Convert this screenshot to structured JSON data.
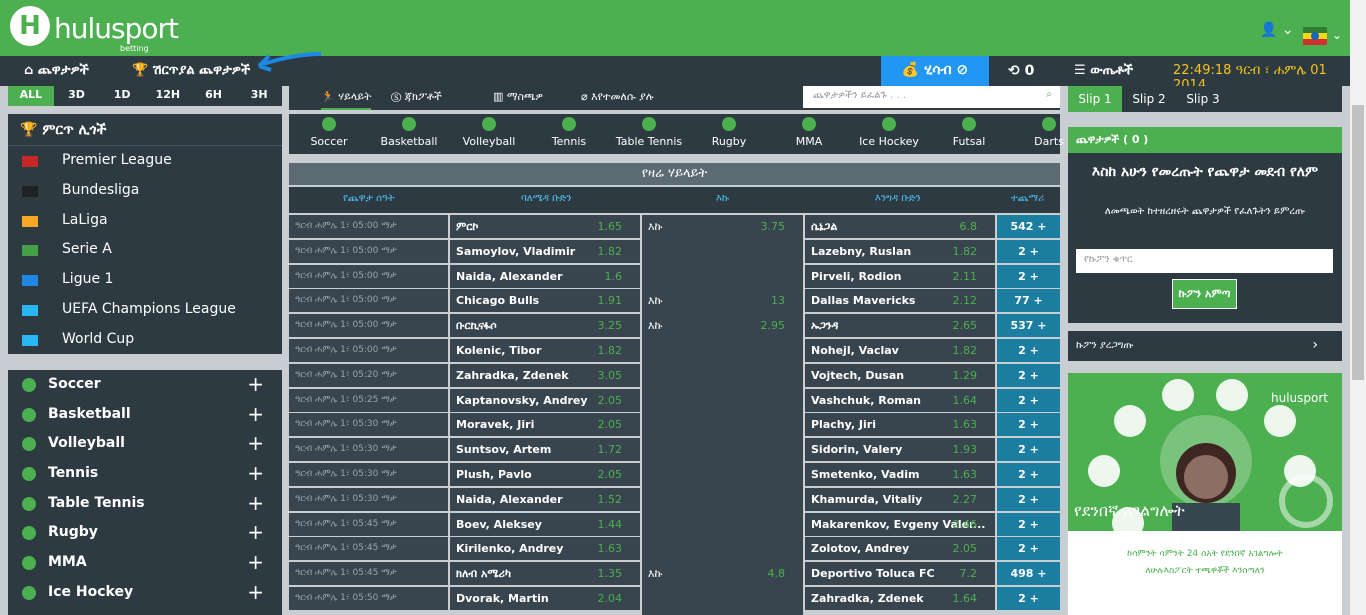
{
  "brand": {
    "name": "hulusport",
    "sub": "betting"
  },
  "nav": {
    "home": "ጨዋታዎች",
    "special": "ሽርጥያል ጨዋታዎች",
    "balance": "ሂሳብ",
    "history_count": "0",
    "tickets": "ውጤቶች",
    "clock": "22:49:18 ዓርብ ፣ ሐምሌ 01 2014"
  },
  "periods": [
    "ALL",
    "3D",
    "1D",
    "12H",
    "6H",
    "3H"
  ],
  "top_leagues_title": "ምርጥ ሊጎች",
  "leagues": [
    {
      "name": "Premier League",
      "flag": "#c62828"
    },
    {
      "name": "Bundesliga",
      "flag": "#212121"
    },
    {
      "name": "LaLiga",
      "flag": "#f9a825"
    },
    {
      "name": "Serie A",
      "flag": "#43a047"
    },
    {
      "name": "Ligue 1",
      "flag": "#1e88e5"
    },
    {
      "name": "UEFA Champions League",
      "flag": "#29b6f6"
    },
    {
      "name": "World Cup",
      "flag": "#29b6f6"
    }
  ],
  "sports": [
    "Soccer",
    "Basketball",
    "Volleyball",
    "Tennis",
    "Table Tennis",
    "Rugby",
    "MMA",
    "Ice Hockey"
  ],
  "tabs": [
    "ሃይላይት",
    "ጃክፖቶች",
    "ማስጫዎ",
    "እየተመለሱ ያሉ"
  ],
  "search_placeholder": "ጨዋታዎችን ይፈልጉ . . .",
  "sportsbar": [
    "Soccer",
    "Basketball",
    "Volleyball",
    "Tennis",
    "Table Tennis",
    "Rugby",
    "MMA",
    "Ice Hockey",
    "Futsal",
    "Darts"
  ],
  "highlights_title": "የዛሬ ሃይላይት",
  "columns": [
    "የጨዋታ ሰዓት",
    "ባለሜዳ ቡድን",
    "እኩ",
    "እንግዳ ቡድን",
    "ተጨማሪ"
  ],
  "rows": [
    {
      "time": "ዓርብ ሐምሌ 1፣ 05:00 ማታ",
      "home": "ምርኮ",
      "ho": "1.65",
      "draw": "እኩ",
      "do": "3.75",
      "away": "ሴኔጋል",
      "ao": "6.8",
      "more": "542 +"
    },
    {
      "time": "ዓርብ ሐምሌ 1፣ 05:00 ማታ",
      "home": "Samoylov, Vladimir",
      "ho": "1.82",
      "draw": "",
      "do": "",
      "away": "Lazebny, Ruslan",
      "ao": "1.82",
      "more": "2 +"
    },
    {
      "time": "ዓርብ ሐምሌ 1፣ 05:00 ማታ",
      "home": "Naida, Alexander",
      "ho": "1.6",
      "draw": "",
      "do": "",
      "away": "Pirveli, Rodion",
      "ao": "2.11",
      "more": "2 +"
    },
    {
      "time": "ዓርብ ሐምሌ 1፣ 05:00 ማታ",
      "home": "Chicago Bulls",
      "ho": "1.91",
      "draw": "እኩ",
      "do": "13",
      "away": "Dallas Mavericks",
      "ao": "2.12",
      "more": "77 +"
    },
    {
      "time": "ዓርብ ሐምሌ 1፣ 05:00 ማታ",
      "home": "ቡርኪናፋሶ",
      "ho": "3.25",
      "draw": "እኩ",
      "do": "2.95",
      "away": "ኡጋንዳ",
      "ao": "2.65",
      "more": "537 +"
    },
    {
      "time": "ዓርብ ሐምሌ 1፣ 05:00 ማታ",
      "home": "Kolenic, Tibor",
      "ho": "1.82",
      "draw": "",
      "do": "",
      "away": "Nohejl, Vaclav",
      "ao": "1.82",
      "more": "2 +"
    },
    {
      "time": "ዓርብ ሐምሌ 1፣ 05:20 ማታ",
      "home": "Zahradka, Zdenek",
      "ho": "3.05",
      "draw": "",
      "do": "",
      "away": "Vojtech, Dusan",
      "ao": "1.29",
      "more": "2 +"
    },
    {
      "time": "ዓርብ ሐምሌ 1፣ 05:25 ማታ",
      "home": "Kaptanovsky, Andrey",
      "ho": "2.05",
      "draw": "",
      "do": "",
      "away": "Vashchuk, Roman",
      "ao": "1.64",
      "more": "2 +"
    },
    {
      "time": "ዓርብ ሐምሌ 1፣ 05:30 ማታ",
      "home": "Moravek, Jiri",
      "ho": "2.05",
      "draw": "",
      "do": "",
      "away": "Plachy, Jiri",
      "ao": "1.63",
      "more": "2 +"
    },
    {
      "time": "ዓርብ ሐምሌ 1፣ 05:30 ማታ",
      "home": "Suntsov, Artem",
      "ho": "1.72",
      "draw": "",
      "do": "",
      "away": "Sidorin, Valery",
      "ao": "1.93",
      "more": "2 +"
    },
    {
      "time": "ዓርብ ሐምሌ 1፣ 05:30 ማታ",
      "home": "Plush, Pavlo",
      "ho": "2.05",
      "draw": "",
      "do": "",
      "away": "Smetenko, Vadim",
      "ao": "1.63",
      "more": "2 +"
    },
    {
      "time": "ዓርብ ሐምሌ 1፣ 05:30 ማታ",
      "home": "Naida, Alexander",
      "ho": "1.52",
      "draw": "",
      "do": "",
      "away": "Khamurda, Vitaliy",
      "ao": "2.27",
      "more": "2 +"
    },
    {
      "time": "ዓርብ ሐምሌ 1፣ 05:45 ማታ",
      "home": "Boev, Aleksey",
      "ho": "1.44",
      "draw": "",
      "do": "",
      "away": "Makarenkov, Evgeny Valer...",
      "ao": "2.46",
      "more": "2 +"
    },
    {
      "time": "ዓርብ ሐምሌ 1፣ 05:45 ማታ",
      "home": "Kirilenko, Andrey",
      "ho": "1.63",
      "draw": "",
      "do": "",
      "away": "Zolotov, Andrey",
      "ao": "2.05",
      "more": "2 +"
    },
    {
      "time": "ዓርብ ሐምሌ 1፣ 05:45 ማታ",
      "home": "ክለብ አሜሪካ",
      "ho": "1.35",
      "draw": "እኩ",
      "do": "4.8",
      "away": "Deportivo Toluca FC",
      "ao": "7.2",
      "more": "498 +"
    },
    {
      "time": "ዓርብ ሐምሌ 1፣ 05:50 ማታ",
      "home": "Dvorak, Martin",
      "ho": "2.04",
      "draw": "",
      "do": "",
      "away": "Zahradka, Zdenek",
      "ao": "1.64",
      "more": "2 +"
    }
  ],
  "slips": [
    "Slip 1",
    "Slip 2",
    "Slip 3"
  ],
  "betslip": {
    "header": "ጨዋታዎች ( 0 )",
    "empty": "እስከ አሁን የመረጡት የጨዋታ መደብ የለም",
    "hint": "ለመጫወት ከተዘረዘሩት ጨዋታዎች የፈለጉትን ይምረጡ",
    "coupon_placeholder": "የኩፖን ቁጥር",
    "coupon_btn": "ኩፖን አምጣ",
    "check": "ኩፖን ያረጋግጡ"
  },
  "ad": {
    "title": "የደንበኛ አገልግሎት",
    "line1": "ከሳምንት ሳምንት 24 ሰአት የደንበኛ አገልግሎት",
    "line2": "ለሁሉእስፖርት ተጫዋቾች እንሰጣለን"
  }
}
